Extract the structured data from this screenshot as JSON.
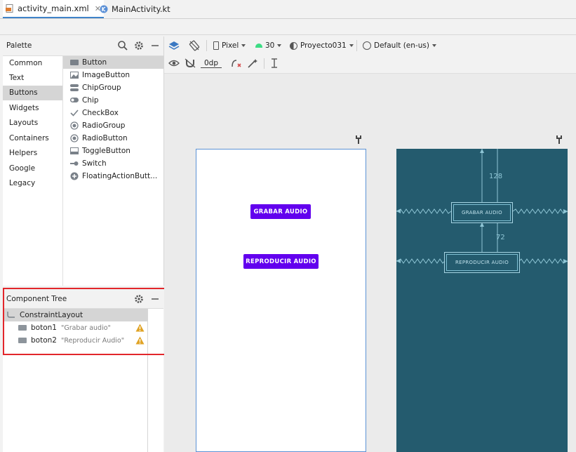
{
  "tabs": [
    {
      "label": "activity_main.xml",
      "icon": "xml-file-icon",
      "active": true,
      "close": "✕"
    },
    {
      "label": "MainActivity.kt",
      "icon": "kotlin-file-icon",
      "active": false
    }
  ],
  "palette": {
    "title": "Palette",
    "categories": [
      "Common",
      "Text",
      "Buttons",
      "Widgets",
      "Layouts",
      "Containers",
      "Helpers",
      "Google",
      "Legacy"
    ],
    "selected_category": "Buttons",
    "items": [
      {
        "label": "Button",
        "icon": "button-icon"
      },
      {
        "label": "ImageButton",
        "icon": "image-button-icon"
      },
      {
        "label": "ChipGroup",
        "icon": "chip-group-icon"
      },
      {
        "label": "Chip",
        "icon": "chip-icon"
      },
      {
        "label": "CheckBox",
        "icon": "checkbox-icon"
      },
      {
        "label": "RadioGroup",
        "icon": "radio-group-icon"
      },
      {
        "label": "RadioButton",
        "icon": "radio-button-icon"
      },
      {
        "label": "ToggleButton",
        "icon": "toggle-button-icon"
      },
      {
        "label": "Switch",
        "icon": "switch-icon"
      },
      {
        "label": "FloatingActionButt...",
        "icon": "fab-icon"
      }
    ]
  },
  "component_tree": {
    "title": "Component Tree",
    "root": "ConstraintLayout",
    "children": [
      {
        "id": "boton1",
        "hint": "\"Grabar audio\""
      },
      {
        "id": "boton2",
        "hint": "\"Reproducir Audio\""
      }
    ]
  },
  "toolbar": {
    "device": "Pixel",
    "api": "30",
    "theme": "Proyecto031",
    "locale": "Default (en-us)",
    "margin": "0dp"
  },
  "design": {
    "button1": "GRABAR AUDIO",
    "button2": "REPRODUCIR AUDIO",
    "accent": "#6200ee"
  },
  "blueprint": {
    "button1": "GRABAR AUDIO",
    "button2": "REPRODUCIR AUDIO",
    "top_margin": "128",
    "between_margin": "72",
    "background": "#245b6e"
  }
}
